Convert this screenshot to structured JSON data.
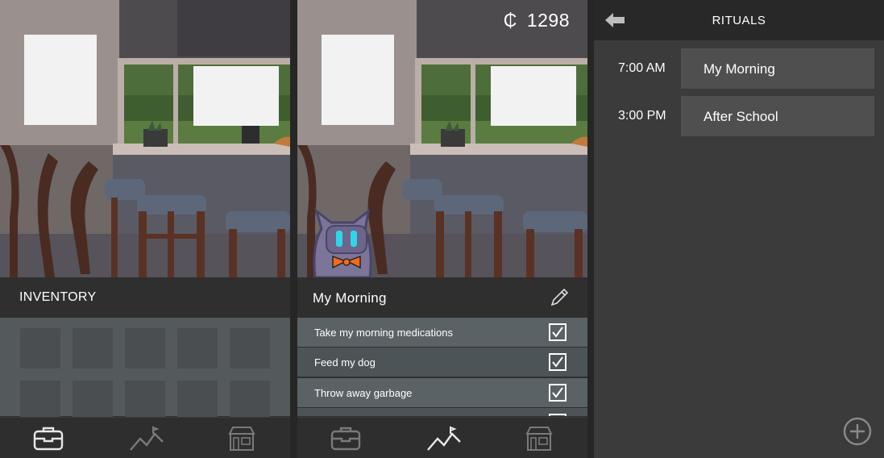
{
  "inventory_panel": {
    "header": "INVENTORY",
    "nav": [
      {
        "icon": "inventory-box-icon",
        "active": true
      },
      {
        "icon": "rituals-path-icon",
        "active": false
      },
      {
        "icon": "store-icon",
        "active": false
      }
    ]
  },
  "ritual_panel": {
    "currency": {
      "symbol": "₵",
      "amount": "1298"
    },
    "header": "My Morning",
    "tasks": [
      {
        "label": "Take my morning medications",
        "checked": true
      },
      {
        "label": "Feed my dog",
        "checked": true
      },
      {
        "label": "Throw away garbage",
        "checked": true
      }
    ]
  },
  "rituals_panel": {
    "title": "RITUALS",
    "items": [
      {
        "time": "7:00 AM",
        "name": "My Morning"
      },
      {
        "time": "3:00 PM",
        "name": "After School"
      }
    ]
  },
  "colors": {
    "accent_bowtie": "#f26b1d",
    "robot_eyes": "#2fd6e8",
    "row_light": "#5b6265",
    "row_dark": "#4d5457"
  }
}
